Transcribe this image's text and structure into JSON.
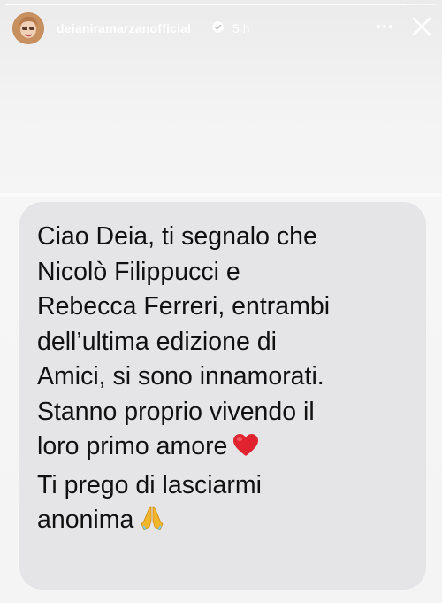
{
  "story": {
    "progress": 0.93,
    "header": {
      "username": "deianiramarzanofficial",
      "time": "5 h",
      "icons": {
        "avatar": "avatar",
        "verified": "verified-badge-icon",
        "more": "more-options-icon",
        "close": "close-icon"
      }
    },
    "message": {
      "lines": [
        "Ciao Deia, ti segnalo che",
        "Nicolò Filippucci e",
        "Rebecca Ferreri, entrambi",
        "dell’ultima edizione di",
        "Amici, si sono innamorati.",
        "Stanno proprio vivendo il",
        "loro primo amore",
        "Ti prego di lasciarmi",
        "anonima"
      ],
      "emojis": {
        "line_7": "red-heart-icon",
        "line_9": "folded-hands-icon"
      }
    },
    "colors": {
      "bubble": "#e5e5e7",
      "text": "#111111",
      "heart": "#e0232e",
      "hands": "#f5b52a"
    }
  }
}
